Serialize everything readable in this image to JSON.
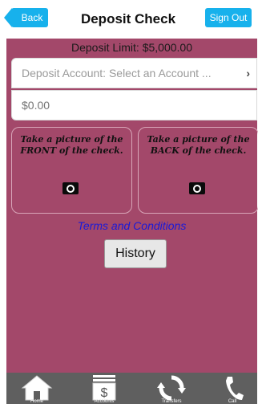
{
  "header": {
    "back_label": "Back",
    "title": "Deposit Check",
    "signout_label": "Sign Out"
  },
  "form": {
    "deposit_limit": "Deposit Limit: $5,000.00",
    "account_placeholder": "Deposit Account: Select an Account ...",
    "amount_placeholder": "$0.00"
  },
  "capture": {
    "front_text": "Take a picture of the FRONT of the check.",
    "back_text": "Take a picture of the BACK of the check."
  },
  "links": {
    "terms_label": "Terms and Conditions",
    "history_label": "History"
  },
  "tabs": [
    {
      "label": "Home",
      "icon": "home-icon"
    },
    {
      "label": "Accounts",
      "icon": "accounts-icon"
    },
    {
      "label": "Transfers",
      "icon": "transfer-icon"
    },
    {
      "label": "Call",
      "icon": "phone-icon"
    }
  ],
  "colors": {
    "accent": "#17b1ec",
    "panel": "#a3486a",
    "tabbar": "#5f5f5f",
    "link": "#1a1ad8"
  }
}
